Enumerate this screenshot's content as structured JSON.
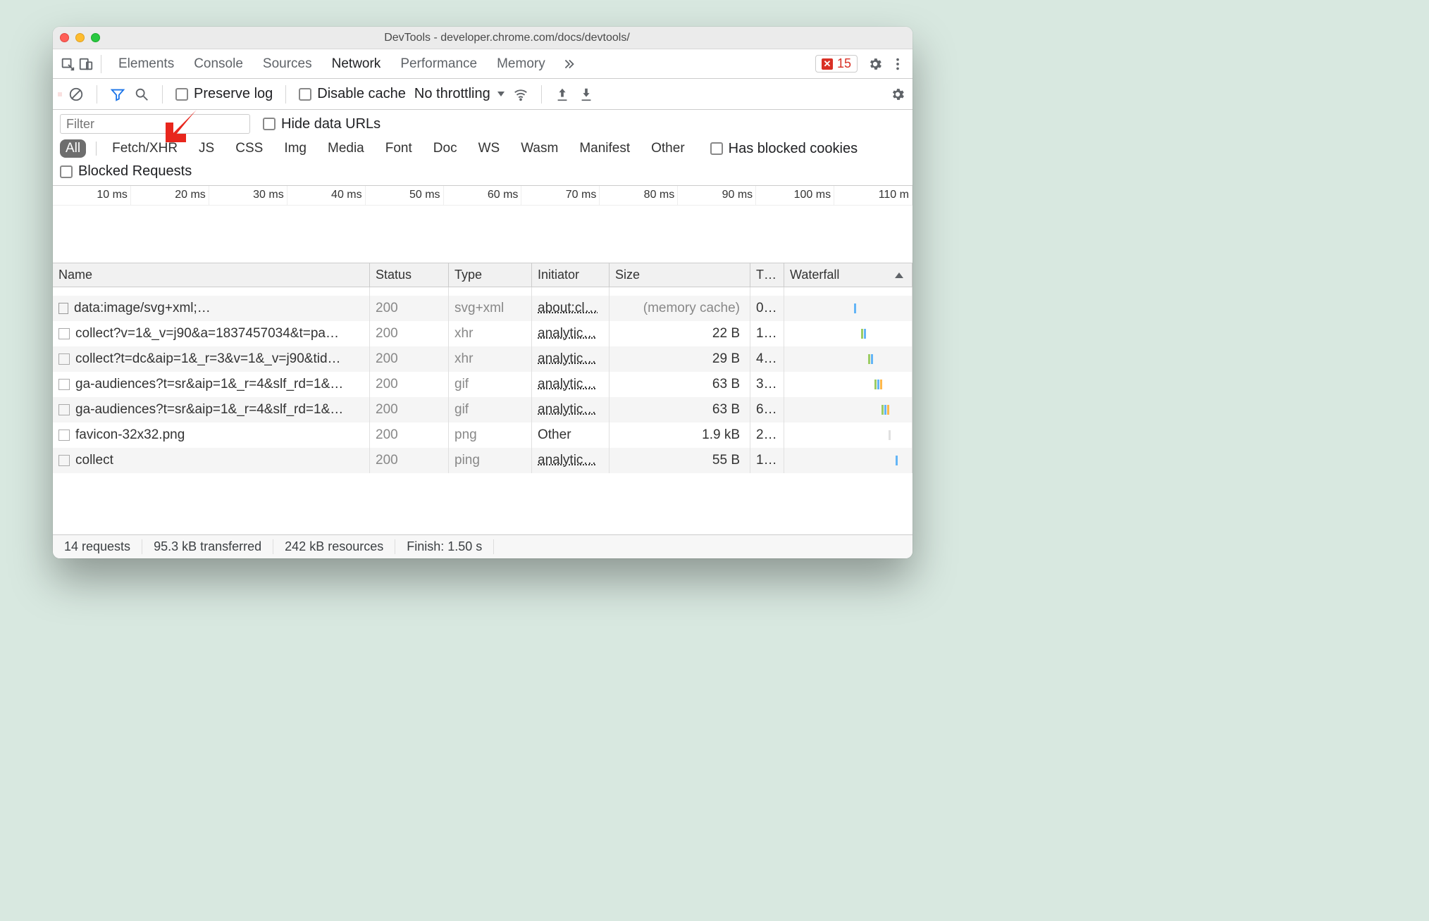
{
  "window": {
    "title": "DevTools - developer.chrome.com/docs/devtools/"
  },
  "tabs": {
    "items": [
      "Elements",
      "Console",
      "Sources",
      "Network",
      "Performance",
      "Memory"
    ],
    "active": "Network",
    "error_count": "15"
  },
  "toolbar": {
    "preserve_log": "Preserve log",
    "disable_cache": "Disable cache",
    "throttling": "No throttling"
  },
  "filter": {
    "placeholder": "Filter",
    "hide_data_urls": "Hide data URLs",
    "types": [
      "All",
      "Fetch/XHR",
      "JS",
      "CSS",
      "Img",
      "Media",
      "Font",
      "Doc",
      "WS",
      "Wasm",
      "Manifest",
      "Other"
    ],
    "active_type": "All",
    "has_blocked": "Has blocked cookies",
    "blocked_requests": "Blocked Requests"
  },
  "timeline": {
    "ticks": [
      "10 ms",
      "20 ms",
      "30 ms",
      "40 ms",
      "50 ms",
      "60 ms",
      "70 ms",
      "80 ms",
      "90 ms",
      "100 ms",
      "110 m"
    ]
  },
  "columns": {
    "name": "Name",
    "status": "Status",
    "type": "Type",
    "initiator": "Initiator",
    "size": "Size",
    "time": "T…",
    "waterfall": "Waterfall"
  },
  "rows": [
    {
      "name": "data:image/svg+xml;…",
      "status": "200",
      "type": "svg+xml",
      "initiator": "about:cl…",
      "initiator_link": true,
      "size": "(memory cache)",
      "size_muted": true,
      "time": "0…",
      "icon": "doc"
    },
    {
      "name": "collect?v=1&_v=j90&a=1837457034&t=pa…",
      "status": "200",
      "type": "xhr",
      "initiator": "analytic…",
      "initiator_link": true,
      "size": "22 B",
      "time": "1…",
      "icon": "blank"
    },
    {
      "name": "collect?t=dc&aip=1&_r=3&v=1&_v=j90&tid…",
      "status": "200",
      "type": "xhr",
      "initiator": "analytic…",
      "initiator_link": true,
      "size": "29 B",
      "time": "4…",
      "icon": "blank"
    },
    {
      "name": "ga-audiences?t=sr&aip=1&_r=4&slf_rd=1&…",
      "status": "200",
      "type": "gif",
      "initiator": "analytic…",
      "initiator_link": true,
      "size": "63 B",
      "time": "3…",
      "icon": "blank"
    },
    {
      "name": "ga-audiences?t=sr&aip=1&_r=4&slf_rd=1&…",
      "status": "200",
      "type": "gif",
      "initiator": "analytic…",
      "initiator_link": true,
      "size": "63 B",
      "time": "6…",
      "icon": "blank"
    },
    {
      "name": "favicon-32x32.png",
      "status": "200",
      "type": "png",
      "initiator": "Other",
      "initiator_link": false,
      "size": "1.9 kB",
      "time": "2…",
      "icon": "blank"
    },
    {
      "name": "collect",
      "status": "200",
      "type": "ping",
      "initiator": "analytic…",
      "initiator_link": true,
      "size": "55 B",
      "time": "1…",
      "icon": "blank"
    }
  ],
  "status": {
    "requests": "14 requests",
    "transferred": "95.3 kB transferred",
    "resources": "242 kB resources",
    "finish": "Finish: 1.50 s"
  }
}
